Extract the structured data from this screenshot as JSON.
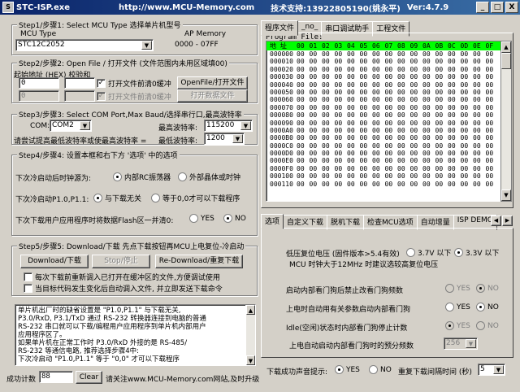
{
  "window": {
    "name": "STC-ISP.exe",
    "url": "http://www.MCU-Memory.com",
    "support": "技术支持:13922805190(姚永平)",
    "version": "Ver:4.7.9",
    "min": "_",
    "max": "□",
    "close": "X"
  },
  "step1": {
    "legend": "Step1/步骤1: Select MCU Type  选择单片机型号",
    "mcu_type_label": "MCU Type",
    "ap_memory_label": "AP Memory",
    "mcu_value": "STC12C2052",
    "ap_range": "0000   -   07FF"
  },
  "step2": {
    "legend": "Step2/步骤2: Open File / 打开文件 (文件范围内未用区域填00)",
    "start_addr_label": "起始地址 (HEX)  校验和",
    "addr1": "0",
    "addr2": "0",
    "chk1_label": "打开文件前清0缓冲",
    "chk2_label": "打开文件前清0缓冲",
    "open_file_btn": "OpenFile/打开文件",
    "open_data_btn": "打开数据文件"
  },
  "step3": {
    "legend": "Step3/步骤3: Select COM Port,Max Baud/选择串行口,最高波特率",
    "com_label": "COM:",
    "com_value": "COM2",
    "max_baud_label": "最高波特率:",
    "max_baud_value": "115200",
    "min_baud_label": "最低波特率:",
    "min_baud_value": "1200",
    "hint": "请尝试提高最低波特率或使最高波特率 ="
  },
  "step4": {
    "legend": "Step4/步骤4: 设置本框和右下方 '选项' 中的选项",
    "clock_label": "下次冷启动后时钟源为:",
    "clock_opt1": "内部RC振荡器",
    "clock_opt2": "外部晶体或时钟",
    "p1_label": "下次冷启动P1.0,P1.1:",
    "p1_opt1": "与下载无关",
    "p1_opt2": "等于0,0才可以下载程序",
    "flash_label": "下次下载用户应用程序时将数据Flash区一并清0:",
    "yes": "YES",
    "no": "NO"
  },
  "step5": {
    "legend": "Step5/步骤5: Download/下载  先点下载按钮再MCU上电复位-冷启动",
    "download_btn": "Download/下载",
    "stop_btn": "Stop/停止",
    "redownload_btn": "Re-Download/重复下载",
    "chk1_label": "每次下载前重新调入已打开在缓冲区的文件,方便调试使用",
    "chk2_label": "当目标代码发生变化后自动调入文件, 并立即发送下载命令"
  },
  "info_lines": [
    "   单片机出厂时的缺省设置是 \"P1.0,P1.1\" 与下载无关,",
    "P3.0/RxD, P3.1/TxD 通过 RS-232 转换器连接到电脑的普通",
    "RS-232 串口就可以下载/编程用户应用程序到单片机内部用户",
    "应用程序区了。",
    "   如果单片机在正常工作时 P3.0/RxD 外接的是 RS-485/",
    "RS-232 等通信电路, 推荐选择步骤4中:",
    "   下次冷启动 \"P1.0,P1.1\" 等于 \"0,0\" 才可以下载程序"
  ],
  "status": {
    "count_label": "成功计数",
    "count_value": "88",
    "clear_btn": "Clear",
    "notice": "请关注www.MCU-Memory.com网站,及时升级"
  },
  "right_tabs": [
    "程序文件",
    "_no_",
    "串口调试助手",
    "工程文件"
  ],
  "hex": {
    "program_file_label": "Program File:",
    "addr_header": "地 址",
    "col_headers": [
      "00",
      "01",
      "02",
      "03",
      "04",
      "05",
      "06",
      "07",
      "08",
      "09",
      "0A",
      "0B",
      "0C",
      "0D",
      "0E",
      "0F"
    ],
    "rows": [
      "000000",
      "000010",
      "000020",
      "000030",
      "000040",
      "000050",
      "000060",
      "000070",
      "000080",
      "000090",
      "0000A0",
      "0000B0",
      "0000C0",
      "0000D0",
      "0000E0",
      "0000F0",
      "000100",
      "000110"
    ],
    "cell": "00"
  },
  "opt_tabs": [
    "选项",
    "自定义下载",
    "脱机下载",
    "检查MCU选项",
    "自动增量",
    "ISP DEMO"
  ],
  "options": {
    "lvd_label": "低压复位电压 (固件版本>5.4有效)",
    "lvd_opt1": "3.7V 以下",
    "lvd_opt2": "3.3V 以下",
    "lvd_note": "MCU 时钟大于12MHz 时建议选较高复位电压",
    "wdt_start_label": "启动内部看门狗后禁止改看门狗频数",
    "wdt_power_label": "上电时自动用有关参数启动内部看门狗",
    "idle_label": "Idle(空闲)状态时内部看门狗停止计数",
    "prescale_label": "上电自动启动内部看门狗时的预分频数",
    "prescale_value": "256",
    "yes": "YES",
    "no": "NO"
  },
  "sound": {
    "label": "下载成功声音提示:",
    "yes": "YES",
    "no": "NO",
    "interval_label": "重复下载间隔时间 (秒)",
    "interval_value": "5"
  }
}
